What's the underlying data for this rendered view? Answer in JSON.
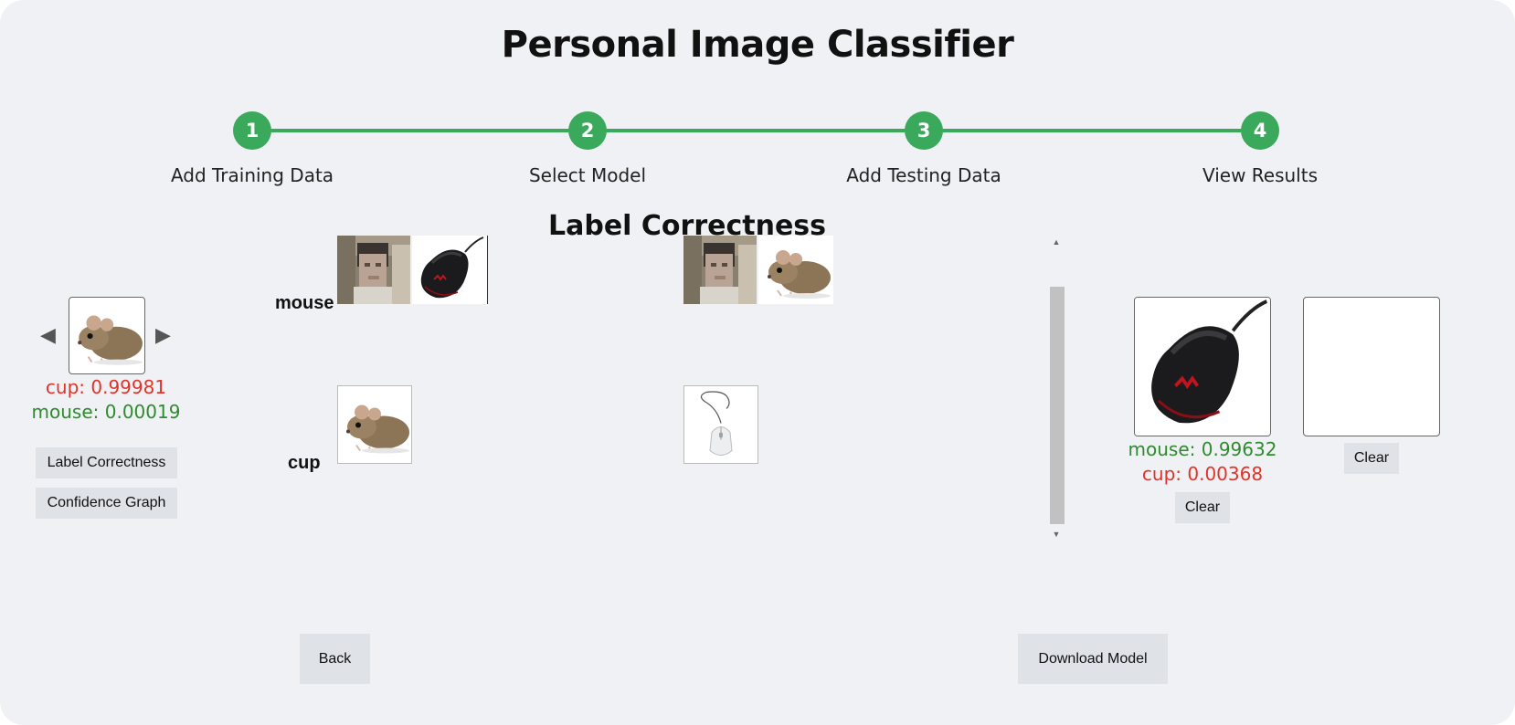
{
  "app": {
    "title": "Personal Image Classifier"
  },
  "steps": [
    {
      "number": "1",
      "label": "Add Training Data"
    },
    {
      "number": "2",
      "label": "Select Model"
    },
    {
      "number": "3",
      "label": "Add Testing Data"
    },
    {
      "number": "4",
      "label": "View Results"
    }
  ],
  "results": {
    "title": "Label Correctness",
    "rows": [
      {
        "label": "mouse",
        "correct_images": [
          "face-image",
          "black-mouse-image"
        ],
        "incorrect_images": [
          "face-image",
          "rodent-image"
        ]
      },
      {
        "label": "cup",
        "correct_images": [
          "rodent-image"
        ],
        "incorrect_images": [
          "white-mouse-image"
        ]
      }
    ]
  },
  "sidebar": {
    "prev_icon": "◀",
    "next_icon": "▶",
    "preview_image": "rodent-image",
    "predictions": [
      {
        "label": "cup: 0.99981",
        "color": "#e0342b"
      },
      {
        "label": "mouse: 0.00019",
        "color": "#2e8b2e"
      }
    ],
    "label_correctness_button": "Label Correctness",
    "confidence_graph_button": "Confidence Graph"
  },
  "test_panel": {
    "slot1": {
      "image": "black-mouse-image",
      "predictions": [
        {
          "label": "mouse: 0.99632",
          "color": "#2e8b2e"
        },
        {
          "label": "cup: 0.00368",
          "color": "#e0342b"
        }
      ],
      "clear_label": "Clear"
    },
    "slot2": {
      "clear_label": "Clear"
    }
  },
  "footer": {
    "back_label": "Back",
    "download_label": "Download Model"
  },
  "colors": {
    "accent": "#3aa95b",
    "background": "#f0f1f4",
    "button": "#dfe2e7"
  }
}
